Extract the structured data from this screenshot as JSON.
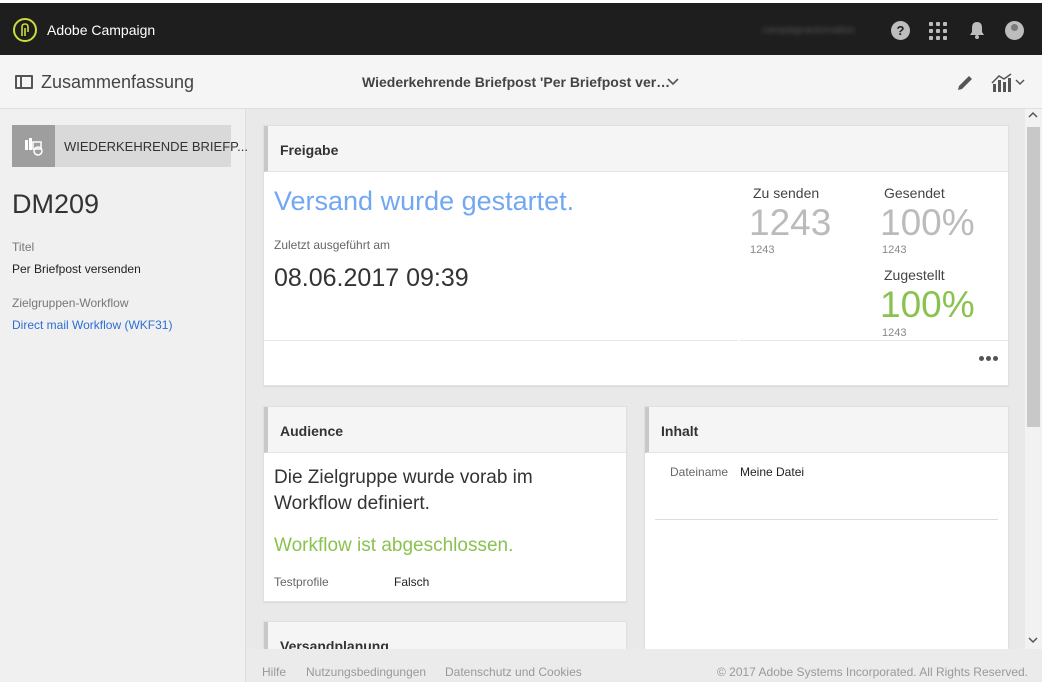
{
  "app": {
    "title": "Adobe Campaign",
    "user": "campaignautomation"
  },
  "header": {
    "page_title": "Zusammenfassung",
    "delivery_title": "Wiederkehrende Briefpost 'Per Briefpost ver…"
  },
  "sidebar": {
    "type_label": "WIEDERKEHRENDE BRIEFP...",
    "code": "DM209",
    "title_label": "Titel",
    "title_value": "Per Briefpost versenden",
    "workflow_label": "Zielgruppen-Workflow",
    "workflow_value": "Direct mail Workflow (WKF31)"
  },
  "freigabe": {
    "heading": "Freigabe",
    "status": "Versand wurde gestartet.",
    "last_run_label": "Zuletzt ausgeführt am",
    "last_run_value": "08.06.2017 09:39",
    "to_send_label": "Zu senden",
    "to_send_value": "1243",
    "to_send_sub": "1243",
    "sent_label": "Gesendet",
    "sent_value": "100%",
    "sent_sub": "1243",
    "delivered_label": "Zugestellt",
    "delivered_value": "100%",
    "delivered_sub": "1243"
  },
  "audience": {
    "heading": "Audience",
    "text": "Die Zielgruppe wurde vorab im Workflow definiert.",
    "status": "Workflow ist abgeschlossen.",
    "test_label": "Testprofile",
    "test_value": "Falsch"
  },
  "inhalt": {
    "heading": "Inhalt",
    "file_label": "Dateiname",
    "file_value": "Meine Datei"
  },
  "schedule": {
    "heading": "Versandplanung"
  },
  "footer": {
    "help": "Hilfe",
    "terms": "Nutzungsbedingungen",
    "privacy": "Datenschutz und Cookies",
    "copyright": "© 2017 Adobe Systems Incorporated. All Rights Reserved."
  },
  "colors": {
    "accent_blue": "#72a7f1",
    "success_green": "#8ac250",
    "logo": "#cddc39",
    "topbar": "#1e1e1e"
  }
}
